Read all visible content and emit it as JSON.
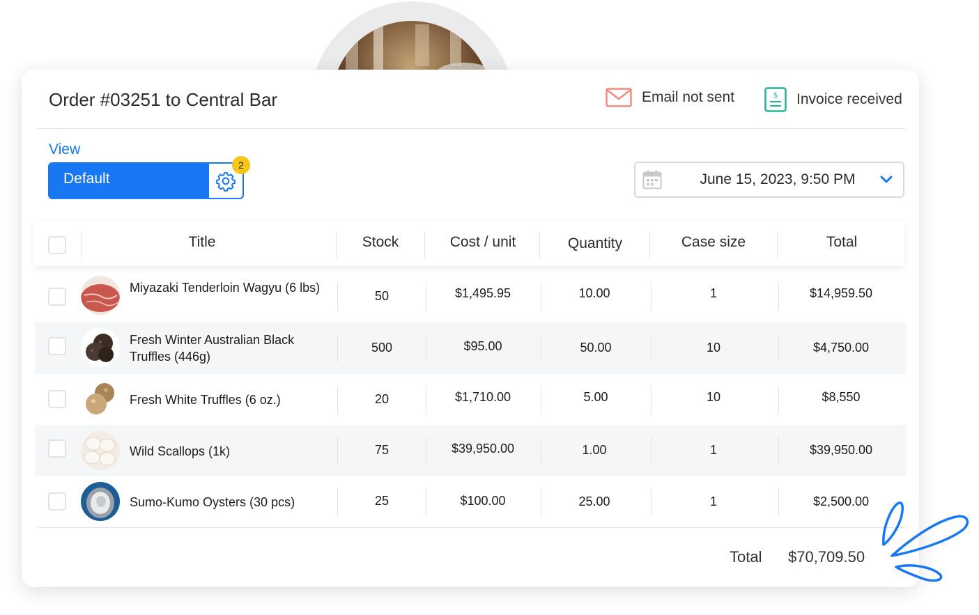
{
  "order": {
    "title": "Order #03251 to Central Bar"
  },
  "status": {
    "email": {
      "label": "Email not sent",
      "icon": "envelope-icon",
      "color": "#f08a7e"
    },
    "invoice": {
      "label": "Invoice received",
      "icon": "invoice-icon",
      "color": "#1fb58f"
    }
  },
  "view": {
    "label": "View",
    "selected": "Default",
    "badge_count": "2",
    "accent": "#1877f2"
  },
  "date": {
    "value": "June 15, 2023, 9:50 PM"
  },
  "table": {
    "headers": [
      "Title",
      "Stock",
      "Cost / unit",
      "Quantity",
      "Case size",
      "Total"
    ],
    "rows": [
      {
        "title": "Miyazaki Tenderloin Wagyu (6 lbs)",
        "stock": "50",
        "cost": "$1,495.95",
        "quantity": "10.00",
        "case_size": "1",
        "total": "$14,959.50",
        "thumb": "wagyu"
      },
      {
        "title": "Fresh Winter Australian Black Truffles (446g)",
        "stock": "500",
        "cost": "$95.00",
        "quantity": "50.00",
        "case_size": "10",
        "total": "$4,750.00",
        "thumb": "black-truffle"
      },
      {
        "title": "Fresh White Truffles (6 oz.)",
        "stock": "20",
        "cost": "$1,710.00",
        "quantity": "5.00",
        "case_size": "10",
        "total": "$8,550",
        "thumb": "white-truffle"
      },
      {
        "title": "Wild Scallops (1k)",
        "stock": "75",
        "cost": "$39,950.00",
        "quantity": "1.00",
        "case_size": "1",
        "total": "$39,950.00",
        "thumb": "scallops"
      },
      {
        "title": "Sumo-Kumo Oysters (30 pcs)",
        "stock": "25",
        "cost": "$100.00",
        "quantity": "25.00",
        "case_size": "1",
        "total": "$2,500.00",
        "thumb": "oyster"
      }
    ]
  },
  "summary": {
    "total_label": "Total",
    "total_value": "$70,709.50"
  }
}
